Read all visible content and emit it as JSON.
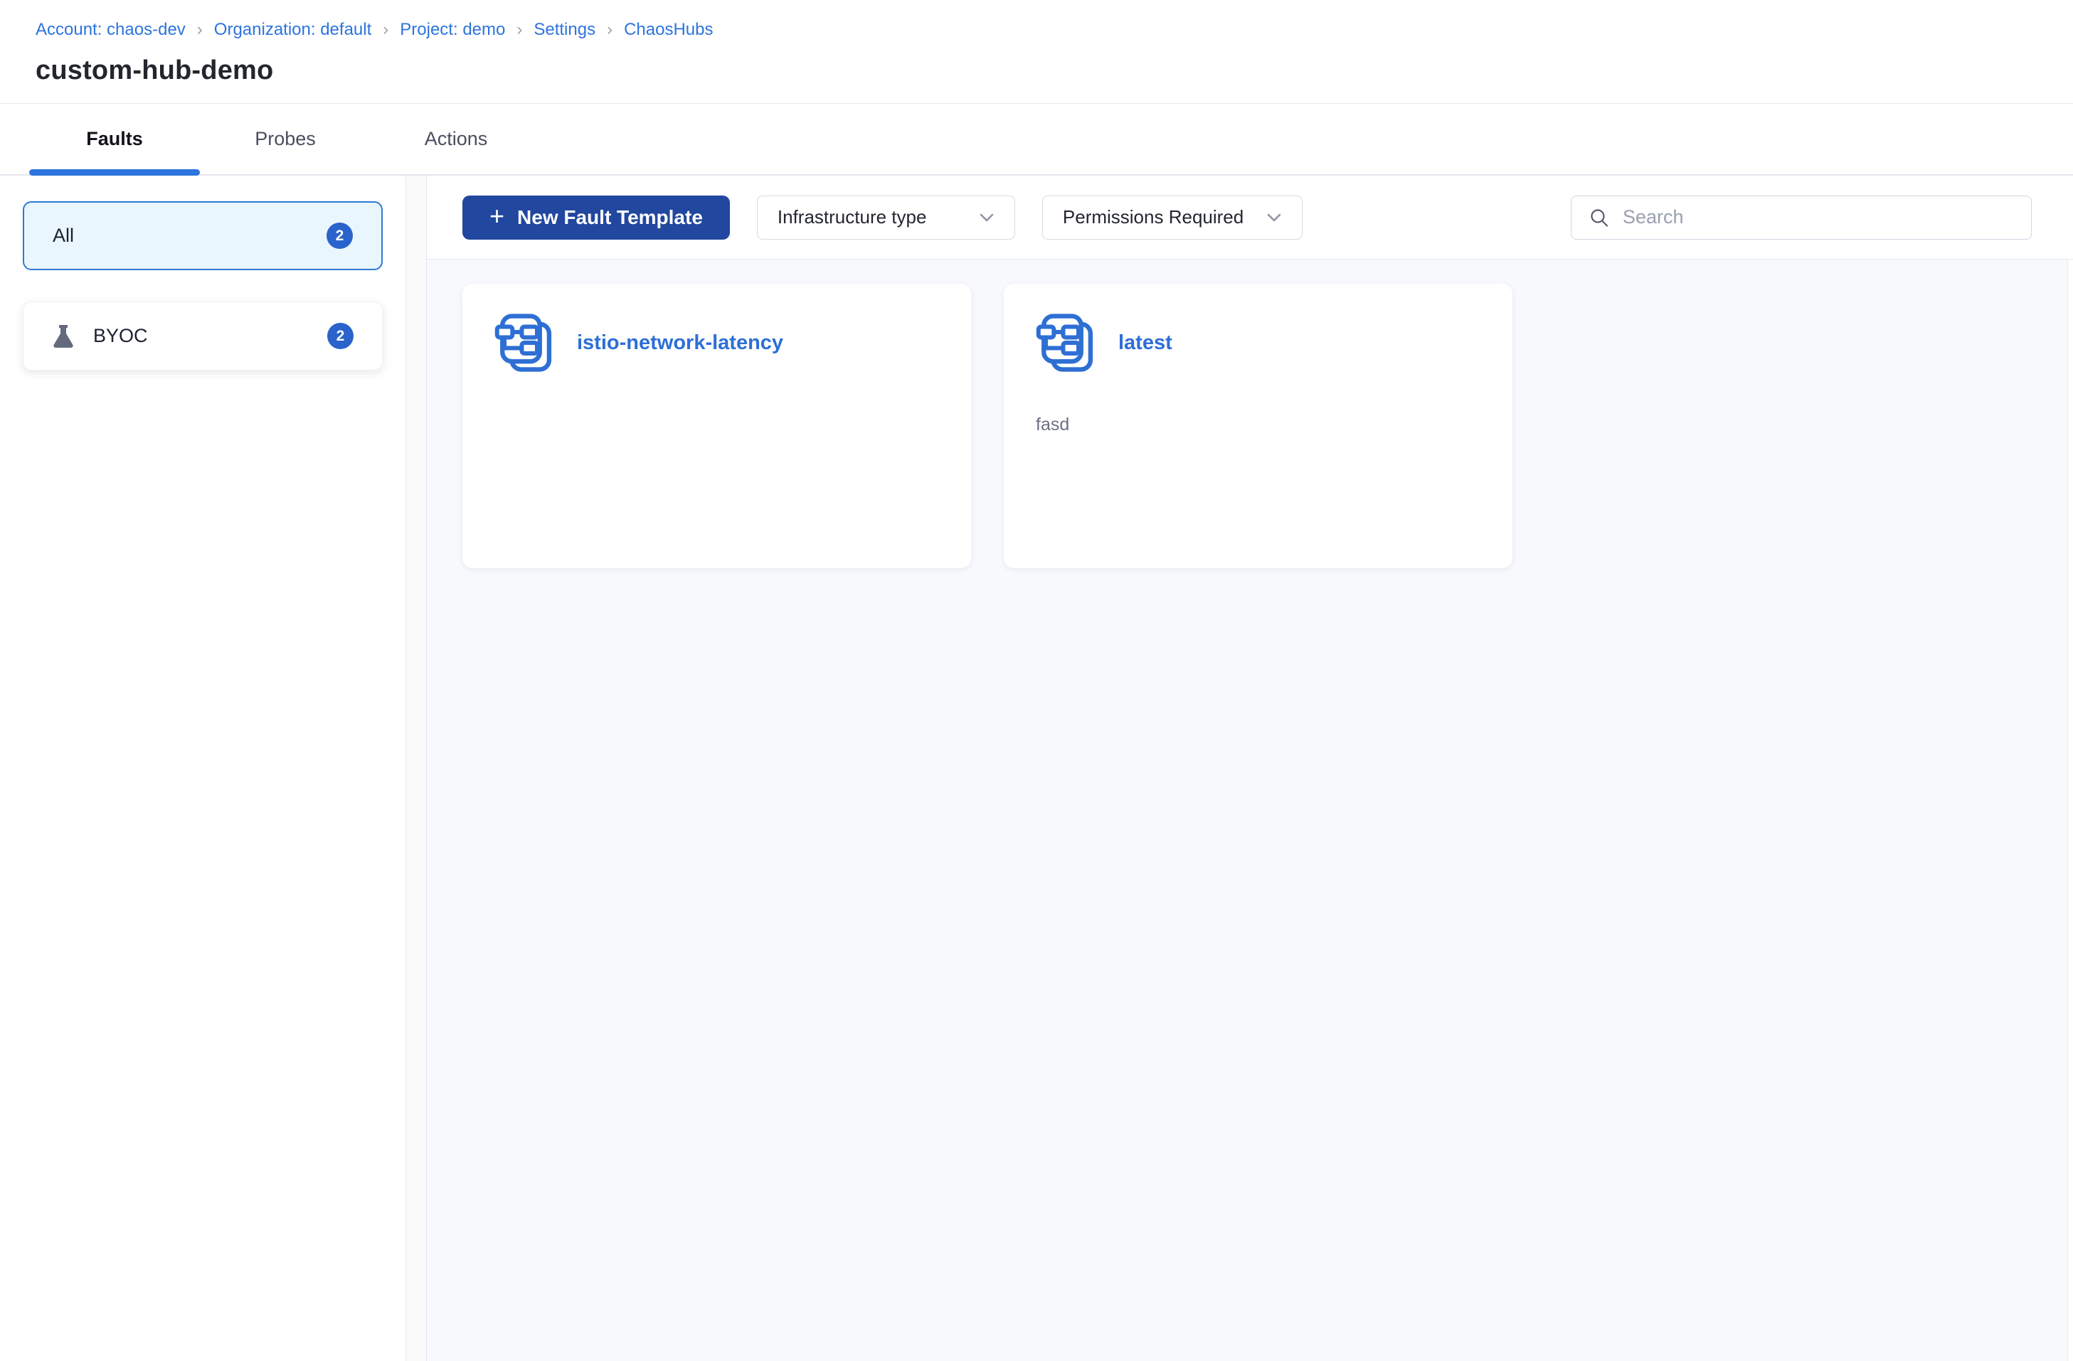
{
  "breadcrumb": {
    "separator": "›",
    "items": [
      {
        "label": "Account: chaos-dev"
      },
      {
        "label": "Organization: default"
      },
      {
        "label": "Project: demo"
      },
      {
        "label": "Settings"
      },
      {
        "label": "ChaosHubs"
      }
    ]
  },
  "header": {
    "title": "custom-hub-demo"
  },
  "tabs": [
    {
      "label": "Faults",
      "active": true
    },
    {
      "label": "Probes",
      "active": false
    },
    {
      "label": "Actions",
      "active": false
    }
  ],
  "sidebar": {
    "items": [
      {
        "label": "All",
        "count": "2",
        "selected": true,
        "icon": null
      },
      {
        "label": "BYOC",
        "count": "2",
        "selected": false,
        "icon": "flask-icon"
      }
    ]
  },
  "toolbar": {
    "plus_glyph": "+",
    "new_fault_template_label": "New Fault Template",
    "infrastructure_filter_label": "Infrastructure type",
    "permissions_filter_label": "Permissions Required",
    "search_placeholder": "Search"
  },
  "cards": [
    {
      "title": "istio-network-latency",
      "description": ""
    },
    {
      "title": "latest",
      "description": "fasd"
    }
  ],
  "colors": {
    "link_blue": "#2d74dd",
    "primary_button_blue": "#21479f",
    "badge_blue": "#2a63cb",
    "selected_filter_bg": "#e9f6fd",
    "selected_filter_border": "#2c7ad4",
    "card_title_blue": "#2d6fd6",
    "main_background": "#f8f9fd",
    "divider": "#e4e5ec",
    "tab_underline": "#2d74dd"
  }
}
